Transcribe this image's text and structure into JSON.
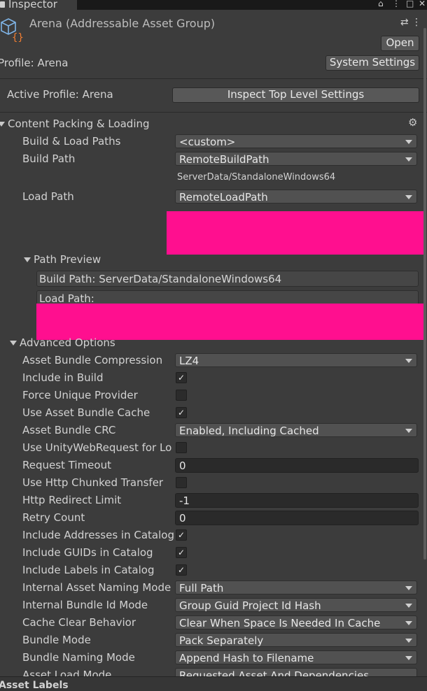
{
  "tab": {
    "title": "Inspector"
  },
  "window_icons": {
    "lock": "lock-icon",
    "maximize": "maximize-icon",
    "close": "close-icon"
  },
  "header": {
    "title": "Arena (Addressable Asset Group)",
    "open_label": "Open",
    "profile_label": "Profile: Arena",
    "system_settings_label": "System Settings"
  },
  "active_profile": {
    "label": "Active Profile: Arena",
    "button": "Inspect Top Level Settings"
  },
  "content_packing": {
    "title": "Content Packing & Loading",
    "build_load_paths": {
      "label": "Build & Load Paths",
      "value": "<custom>"
    },
    "build_path": {
      "label": "Build Path",
      "value": "RemoteBuildPath",
      "resolved": "ServerData/StandaloneWindows64"
    },
    "load_path": {
      "label": "Load Path",
      "value": "RemoteLoadPath"
    },
    "path_preview": {
      "title": "Path Preview",
      "build_path": "Build Path: ServerData/StandaloneWindows64",
      "load_path_label": "Load Path:"
    }
  },
  "advanced": {
    "title": "Advanced Options",
    "rows": {
      "compression": {
        "label": "Asset Bundle Compression",
        "value": "LZ4"
      },
      "include_in_build": {
        "label": "Include in Build",
        "checked": true
      },
      "force_unique": {
        "label": "Force Unique Provider",
        "checked": false
      },
      "use_cache": {
        "label": "Use Asset Bundle Cache",
        "checked": true
      },
      "crc": {
        "label": "Asset Bundle CRC",
        "value": "Enabled, Including Cached"
      },
      "uwr": {
        "label": "Use UnityWebRequest for Loc",
        "checked": false
      },
      "timeout": {
        "label": "Request Timeout",
        "value": "0"
      },
      "chunked": {
        "label": "Use Http Chunked Transfer",
        "checked": false
      },
      "redirect": {
        "label": "Http Redirect Limit",
        "value": "-1"
      },
      "retry": {
        "label": "Retry Count",
        "value": "0"
      },
      "inc_addresses": {
        "label": "Include Addresses in Catalog",
        "checked": true
      },
      "inc_guids": {
        "label": "Include GUIDs in Catalog",
        "checked": true
      },
      "inc_labels": {
        "label": "Include Labels in Catalog",
        "checked": true
      },
      "asset_naming": {
        "label": "Internal Asset Naming Mode",
        "value": "Full Path"
      },
      "bundle_id": {
        "label": "Internal Bundle Id Mode",
        "value": "Group Guid Project Id Hash"
      },
      "cache_clear": {
        "label": "Cache Clear Behavior",
        "value": "Clear When Space Is Needed In Cache"
      },
      "bundle_mode": {
        "label": "Bundle Mode",
        "value": "Pack Separately"
      },
      "bundle_naming": {
        "label": "Bundle Naming Mode",
        "value": "Append Hash to Filename"
      },
      "load_mode": {
        "label": "Asset Load Mode",
        "value": "Requested Asset And Dependencies"
      }
    }
  },
  "footer": {
    "asset_labels": "Asset Labels"
  },
  "colors": {
    "background": "#3c3c3c",
    "redaction": "#ff0f8f",
    "tab_accent": "#3a79bb"
  }
}
